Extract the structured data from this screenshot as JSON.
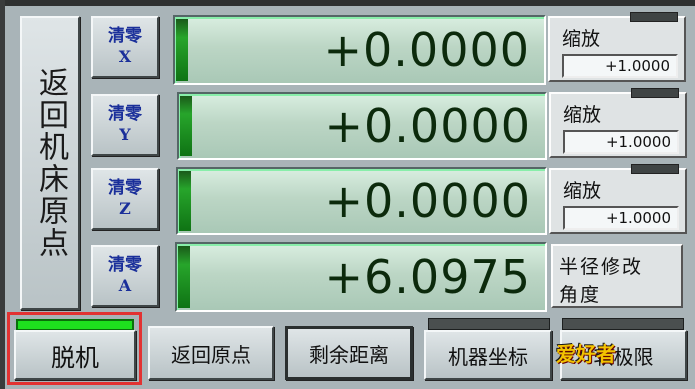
{
  "home_button": "返回机床原点",
  "axes": [
    {
      "zero_line1": "清零",
      "zero_line2": "X",
      "value": "+0.0000",
      "scale_label": "缩放",
      "scale_value": "+1.0000"
    },
    {
      "zero_line1": "清零",
      "zero_line2": "Y",
      "value": "+0.0000",
      "scale_label": "缩放",
      "scale_value": "+1.0000"
    },
    {
      "zero_line1": "清零",
      "zero_line2": "Z",
      "value": "+0.0000",
      "scale_label": "缩放",
      "scale_value": "+1.0000"
    },
    {
      "zero_line1": "清零",
      "zero_line2": "A",
      "value": "+6.0975"
    }
  ],
  "radius_edit": {
    "line1": "半径修改",
    "line2": "角度"
  },
  "bottom_buttons": {
    "offline": "脱机",
    "go_home": "返回原点",
    "remaining": "剩余距离",
    "machine_coords": "机器坐标",
    "soft_limit": "软极限"
  },
  "watermark": "爱好者",
  "colors": {
    "dro_digits": "#0c2a0c",
    "led_on": "#1ee01e",
    "highlight": "#e23232",
    "zero_label": "#1a2f9a"
  }
}
